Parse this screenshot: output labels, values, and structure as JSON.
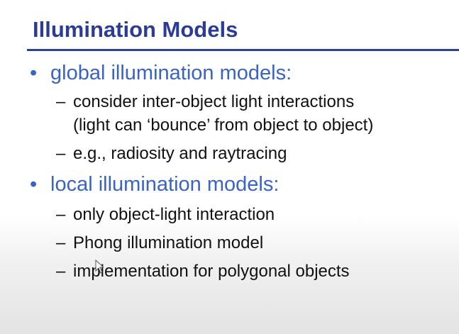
{
  "slide": {
    "title": "Illumination Models",
    "bullets": [
      {
        "marker": "•",
        "text": "global illumination models:",
        "subitems": [
          {
            "marker": "–",
            "lines": [
              "consider inter-object light interactions",
              "(light can ‘bounce’ from object to object)"
            ]
          },
          {
            "marker": "–",
            "lines": [
              "e.g., radiosity and raytracing"
            ]
          }
        ]
      },
      {
        "marker": "•",
        "text": "local illumination models:",
        "subitems": [
          {
            "marker": "–",
            "lines": [
              "only object-light interaction"
            ]
          },
          {
            "marker": "–",
            "lines": [
              "Phong illumination model"
            ]
          },
          {
            "marker": "–",
            "lines": [
              "implementation for polygonal objects"
            ]
          }
        ]
      }
    ]
  },
  "colors": {
    "title": "#2b3c97",
    "rule": "#2d3f97",
    "bullet_text": "#3a63c6",
    "body_text": "#111111",
    "background": "#ffffff"
  },
  "icons": {
    "pointer": "mouse-cursor-icon"
  }
}
